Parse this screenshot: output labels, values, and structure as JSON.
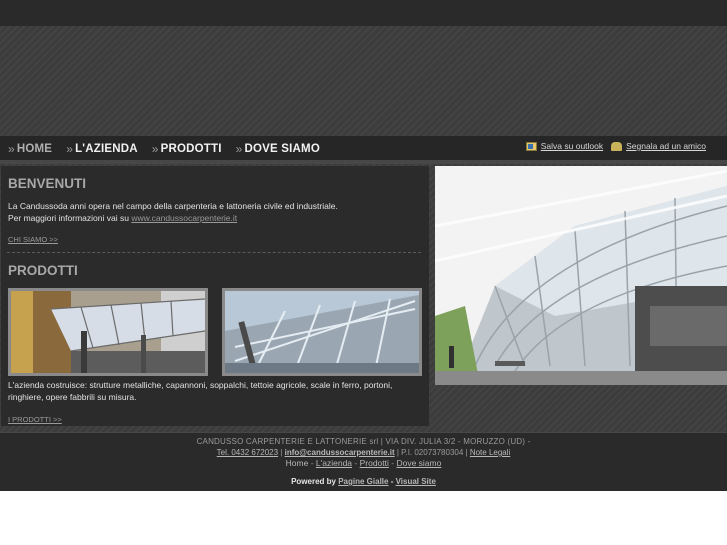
{
  "nav": {
    "items": [
      {
        "label": "HOME",
        "active": true
      },
      {
        "label": "L'AZIENDA",
        "active": false
      },
      {
        "label": "PRODOTTI",
        "active": false
      },
      {
        "label": "DOVE SIAMO",
        "active": false
      }
    ],
    "chevron": "»"
  },
  "utility": {
    "outlook_label": "Salva su outlook",
    "outlook_icon": "contact-card-icon",
    "friend_label": "Segnala ad un amico",
    "friend_icon": "user-share-icon"
  },
  "welcome": {
    "title": "BENVENUTI",
    "line1": "La Candussoda anni opera nel campo della carpenteria e lattoneria civile ed industriale.",
    "line2_prefix": "Per maggiori informazioni vai su ",
    "line2_link": "www.candussocarpenterie.it",
    "more": "CHI SIAMO >>"
  },
  "products": {
    "title": "PRODOTTI",
    "text": "L'azienda costruisce: strutture metalliche, capannoni, soppalchi, tettoie agricole, scale in ferro, portoni, ringhiere, opere fabbrili su misura.",
    "more": "I PRODOTTI >>"
  },
  "footer": {
    "company": "CANDUSSO CARPENTERIE E LATTONERIE srl | VIA DIV. JULIA 3/2 - MORUZZO (UD) -",
    "tel": "Tel. 0432 672023",
    "sep1": " | ",
    "email": "info@candussocarpenterie.it",
    "piva": " | P.I. 02073780304 | ",
    "legal": "Note Legali",
    "links": [
      "Home",
      "L'azienda",
      "Prodotti",
      "Dove siamo"
    ],
    "link_sep": " - ",
    "powered_by": "Powered by",
    "pg": "Pagine Gialle",
    "dash": " - ",
    "vs": "Visual Site"
  },
  "colors": {
    "background": "#3c3c3c",
    "panel": "#2b2b2b",
    "navbar": "#262626",
    "heading": "#a8a8a8",
    "text": "#e2e2e2"
  }
}
